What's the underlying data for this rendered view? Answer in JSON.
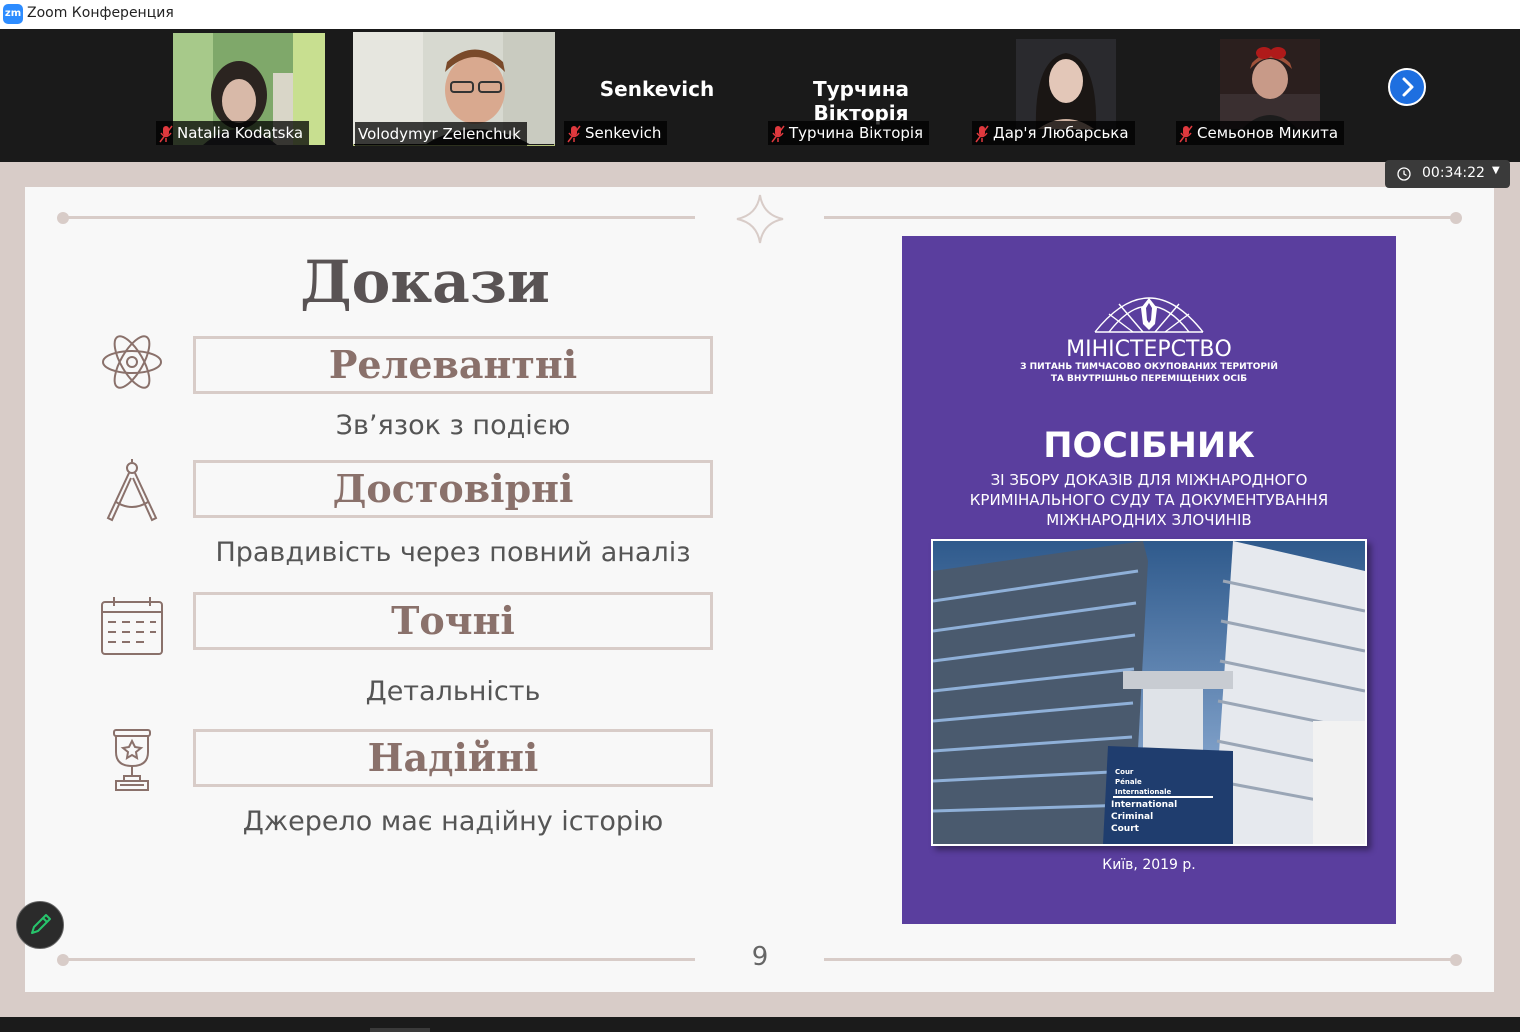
{
  "window": {
    "app_icon": "zm",
    "title": "Zoom Конференция"
  },
  "participants": [
    {
      "name": "Natalia Kodatska",
      "muted": true,
      "video": true
    },
    {
      "name": "Volodymyr Zelenchuk",
      "muted": false,
      "video": true,
      "active_speaker": true
    },
    {
      "name": "Senkevich",
      "display_name": "Senkevich",
      "muted": true,
      "video": false
    },
    {
      "name": "Турчина Вікторія",
      "display_name": "Турчина Вікторія",
      "muted": true,
      "video": false
    },
    {
      "name": "Дар'я Любарська",
      "muted": true,
      "video": true
    },
    {
      "name": "Семьонов Микита",
      "muted": true,
      "video": true
    }
  ],
  "timer": {
    "value": "00:34:22"
  },
  "slide": {
    "title": "Докази",
    "items": [
      {
        "label": "Релевантні",
        "description": "Зв’язок з подією",
        "icon": "atom-icon"
      },
      {
        "label": "Достовірні",
        "description": "Правдивість через повний аналіз",
        "icon": "compass-icon"
      },
      {
        "label": "Точні",
        "description": "Детальність",
        "icon": "calendar-icon"
      },
      {
        "label": "Надійні",
        "description": "Джерело має надійну історію",
        "icon": "trophy-icon"
      }
    ],
    "page_number": "9",
    "cover": {
      "ministry": "МІНІСТЕРСТВО",
      "ministry_sub1": "З ПИТАНЬ ТИМЧАСОВО ОКУПОВАНИХ ТЕРИТОРІЙ",
      "ministry_sub2": "ТА ВНУТРІШНЬО ПЕРЕМІЩЕНИХ ОСІБ",
      "heading": "ПОСІБНИК",
      "subtitle1": "ЗІ ЗБОРУ ДОКАЗІВ ДЛЯ МІЖНАРОДНОГО",
      "subtitle2": "КРИМІНАЛЬНОГО СУДУ ТА ДОКУМЕНТУВАННЯ",
      "subtitle3": "МІЖНАРОДНИХ ЗЛОЧИНІВ",
      "sign_fr1": "Cour",
      "sign_fr2": "Pénale",
      "sign_fr3": "Internationale",
      "sign_en1": "International",
      "sign_en2": "Criminal",
      "sign_en3": "Court",
      "place_year": "Київ, 2019 р."
    }
  },
  "colors": {
    "accent": "#2D8CFF",
    "slide_border": "#d8ccc8",
    "label": "#8a716b",
    "cover": "#5a3e9e"
  }
}
